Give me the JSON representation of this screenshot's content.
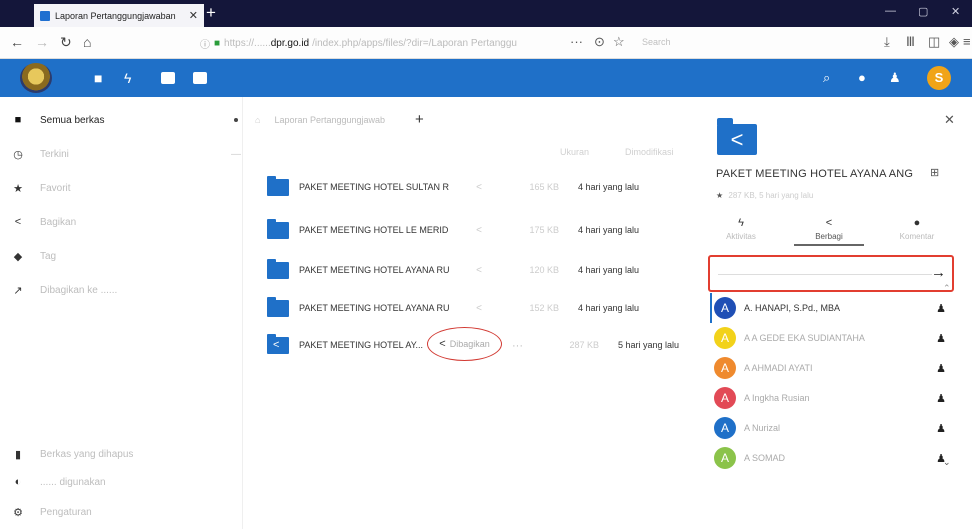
{
  "browser": {
    "tab_title": "Laporan Pertanggungjawaban",
    "tab_close": "✕",
    "new_tab": "+",
    "url_prefix": "https://......",
    "url_domain": "dpr.go.id",
    "url_rest": "/index.php/apps/files/?dir=/Laporan Pertanggu",
    "search_placeholder": "Search",
    "menu_dots": "···"
  },
  "sidebar": {
    "items": [
      {
        "label": "Semua berkas",
        "icon": "folder-icon",
        "glyph": "■"
      },
      {
        "label": "Terkini",
        "icon": "clock-icon",
        "glyph": "◷"
      },
      {
        "label": "Favorit",
        "icon": "star-icon",
        "glyph": "★"
      },
      {
        "label": "Bagikan",
        "icon": "share-icon",
        "glyph": "<"
      },
      {
        "label": "Tag",
        "icon": "tag-icon",
        "glyph": "◆"
      },
      {
        "label": "Dibagikan ke ......",
        "icon": "external-share-icon",
        "glyph": "↗"
      }
    ],
    "bottom": [
      {
        "label": "Berkas yang dihapus",
        "icon": "trash-icon",
        "glyph": "▮"
      },
      {
        "label": "...... digunakan",
        "icon": "quota-icon",
        "glyph": "◐"
      },
      {
        "label": "Pengaturan",
        "icon": "settings-icon",
        "glyph": "⚙"
      }
    ]
  },
  "main": {
    "breadcrumb": "Laporan Pertanggungjawab",
    "add_button": "+",
    "col_size": "Ukuran",
    "col_modified": "Dimodifikasi",
    "files": [
      {
        "name": "PAKET MEETING HOTEL SULTAN RUU ...",
        "size": "165 KB",
        "modified": "4 hari yang lalu",
        "shared": false
      },
      {
        "name": "PAKET MEETING HOTEL LE MERIDIEN ...",
        "size": "175 KB",
        "modified": "4 hari yang lalu",
        "shared": false
      },
      {
        "name": "PAKET MEETING HOTEL AYANA RUU ...",
        "size": "120 KB",
        "modified": "4 hari yang lalu",
        "shared": false
      },
      {
        "name": "PAKET MEETING HOTEL AYANA RUU ...",
        "size": "152 KB",
        "modified": "4 hari yang lalu",
        "shared": false
      },
      {
        "name": "PAKET MEETING HOTEL AY...",
        "size": "287 KB",
        "modified": "5 hari yang lalu",
        "shared": true
      }
    ],
    "shared_label": "Dibagikan"
  },
  "details": {
    "title": "PAKET MEETING HOTEL AYANA ANG",
    "meta": "287 KB, 5 hari yang lalu",
    "tabs": [
      {
        "label": "Aktivitas",
        "glyph": "ϟ"
      },
      {
        "label": "Berbagi",
        "glyph": "<"
      },
      {
        "label": "Komentar",
        "glyph": "●"
      }
    ],
    "share_input_placeholder": "",
    "users": [
      {
        "name": "A. HANAPI, S.Pd., MBA",
        "initial": "A",
        "color": "#1f4fb5",
        "strong": true
      },
      {
        "name": "A A GEDE EKA SUDIANTAHA",
        "initial": "A",
        "color": "#f2d21a",
        "strong": false
      },
      {
        "name": "A AHMADI AYATI",
        "initial": "A",
        "color": "#ef8a2e",
        "strong": false
      },
      {
        "name": "A Ingkha Rusian",
        "initial": "A",
        "color": "#e24a56",
        "strong": false
      },
      {
        "name": "A Nurizal",
        "initial": "A",
        "color": "#1f70c8",
        "strong": false
      },
      {
        "name": "A SOMAD",
        "initial": "A",
        "color": "#8bc34a",
        "strong": false
      }
    ]
  },
  "header": {
    "avatar_initial": "S"
  }
}
